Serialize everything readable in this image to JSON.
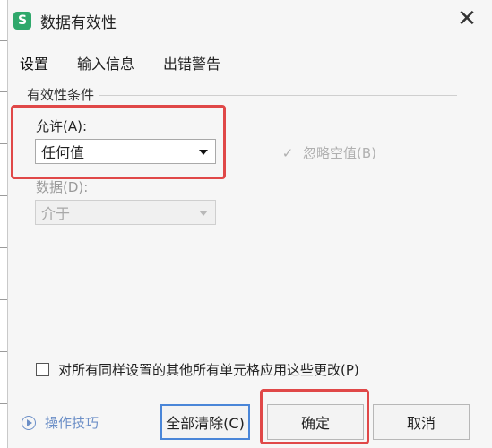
{
  "dialog": {
    "title": "数据有效性",
    "app_icon_letter": "S",
    "close_symbol": "✕"
  },
  "tabs": [
    {
      "label": "设置"
    },
    {
      "label": "输入信息"
    },
    {
      "label": "出错警告"
    }
  ],
  "validation": {
    "group_title": "有效性条件",
    "allow_label": "允许(A):",
    "allow_value": "任何值",
    "ignore_blank_label": "忽略空值(B)",
    "data_label": "数据(D):",
    "data_value": "介于"
  },
  "apply_all_label": "对所有同样设置的其他所有单元格应用这些更改(P)",
  "tips_label": "操作技巧",
  "buttons": {
    "clear_all": "全部清除(C)",
    "ok": "确定",
    "cancel": "取消"
  },
  "colors": {
    "highlight": "#e04848",
    "focus": "#4a86d8",
    "brand": "#2fa86b"
  },
  "icons": {
    "app": "wps-spreadsheet-icon",
    "close": "close-icon",
    "dropdown": "chevron-down-icon",
    "tips": "play-circle-icon"
  }
}
